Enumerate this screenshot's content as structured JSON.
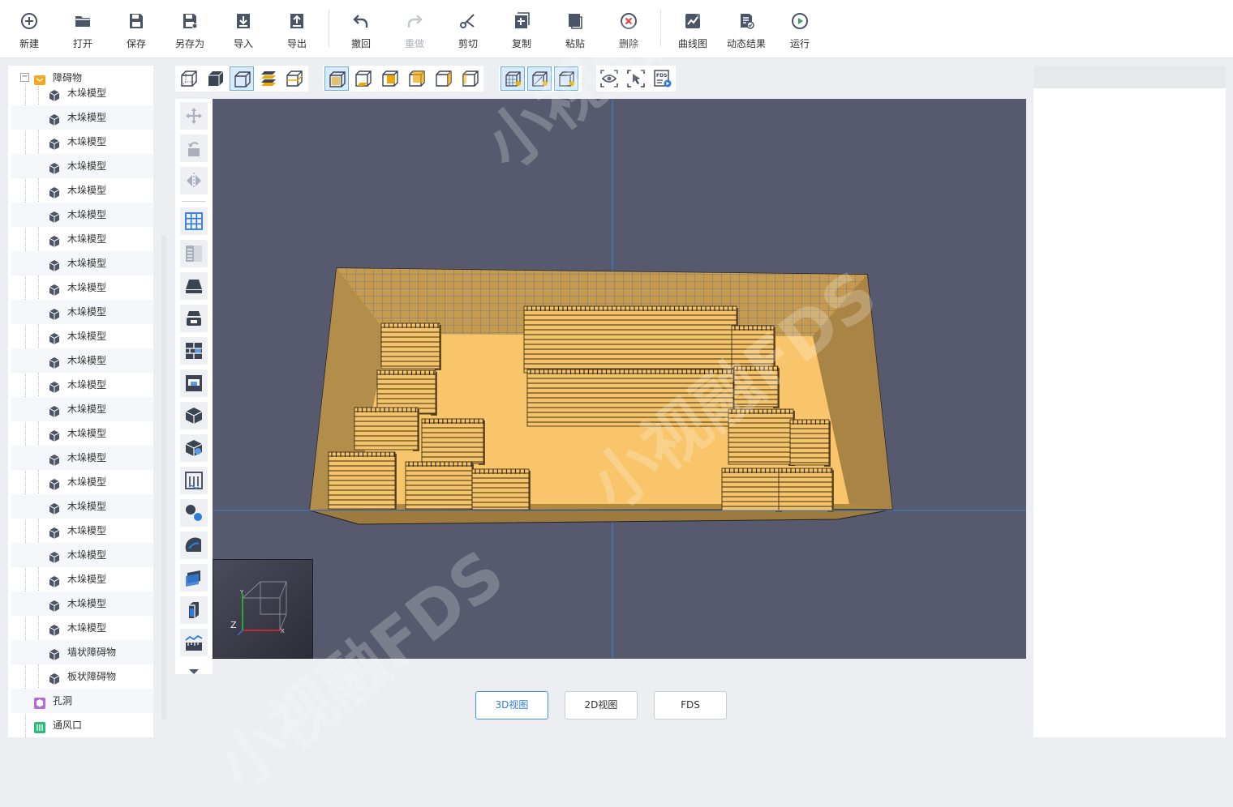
{
  "toolbar": {
    "items": [
      {
        "label": "新建",
        "icon": "new-icon"
      },
      {
        "label": "打开",
        "icon": "open-folder-icon"
      },
      {
        "label": "保存",
        "icon": "save-icon"
      },
      {
        "label": "另存为",
        "icon": "save-as-icon"
      },
      {
        "label": "导入",
        "icon": "import-icon"
      },
      {
        "label": "导出",
        "icon": "export-icon"
      },
      {
        "label": "撤回",
        "icon": "undo-icon"
      },
      {
        "label": "重做",
        "icon": "redo-icon",
        "disabled": true
      },
      {
        "label": "剪切",
        "icon": "cut-icon"
      },
      {
        "label": "复制",
        "icon": "copy-icon"
      },
      {
        "label": "粘贴",
        "icon": "paste-icon"
      },
      {
        "label": "删除",
        "icon": "delete-icon"
      },
      {
        "label": "曲线图",
        "icon": "line-chart-icon"
      },
      {
        "label": "动态结果",
        "icon": "dynamic-result-icon"
      },
      {
        "label": "运行",
        "icon": "run-icon"
      }
    ]
  },
  "tree": {
    "root": {
      "label": "障碍物",
      "icon": "obstacle-folder-icon",
      "expanded": true
    },
    "children": [
      "木垛模型",
      "木垛模型",
      "木垛模型",
      "木垛模型",
      "木垛模型",
      "木垛模型",
      "木垛模型",
      "木垛模型",
      "木垛模型",
      "木垛模型",
      "木垛模型",
      "木垛模型",
      "木垛模型",
      "木垛模型",
      "木垛模型",
      "木垛模型",
      "木垛模型",
      "木垛模型",
      "木垛模型",
      "木垛模型",
      "木垛模型",
      "木垛模型",
      "木垛模型",
      "墙状障碍物",
      "板状障碍物"
    ],
    "siblings": [
      {
        "label": "孔洞",
        "icon": "hole-icon"
      },
      {
        "label": "通风口",
        "icon": "vent-icon"
      }
    ]
  },
  "view_tabs": [
    {
      "label": "3D视图",
      "active": true
    },
    {
      "label": "2D视图",
      "active": false
    },
    {
      "label": "FDS",
      "active": false
    }
  ],
  "viewport": {
    "background": "#575a6e",
    "axis_labels": {
      "y": "Y",
      "z": "Z",
      "x": "X"
    },
    "watermark": "小视融FDS"
  },
  "view_toolbar": {
    "fds_label": "FDS"
  },
  "colors": {
    "accent": "#4a90e2",
    "wood": "#f5c46a",
    "room": "#b38d4a"
  }
}
